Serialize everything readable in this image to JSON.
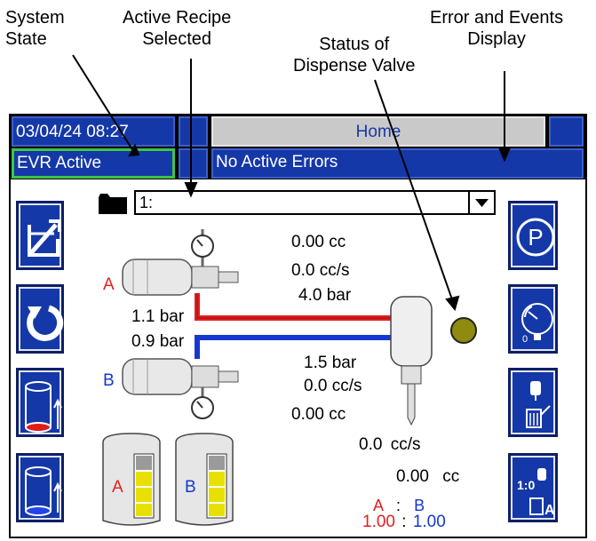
{
  "callouts": {
    "system_state": "System\nState",
    "active_recipe": "Active Recipe\nSelected",
    "dispense_valve": "Status of\nDispense Valve",
    "error_events": "Error and Events\nDisplay"
  },
  "header": {
    "datetime": "03/04/24 08:27",
    "screen_title": "Home",
    "system_state": "EVR Active",
    "error_status": "No Active Errors"
  },
  "recipe": {
    "selected": "1:"
  },
  "readouts": {
    "volume_total": "0.00 cc",
    "flow_rate": "0.0 cc/s",
    "mix_pressure": "4.0 bar",
    "pump_a_pressure": "1.1 bar",
    "pump_b_pressure": "0.9 bar",
    "b_pressure": "1.5 bar",
    "b_flow": "0.0 cc/s",
    "b_volume": "0.00 cc",
    "out_flow": "0.0",
    "out_flow_unit": "cc/s",
    "out_volume": "0.00",
    "out_volume_unit": "cc"
  },
  "labels": {
    "a": "A",
    "b": "B"
  },
  "ratio": {
    "a_label": "A",
    "sep": ":",
    "b_label": "B",
    "a_value": "1.00",
    "b_value": "1.00",
    "sep2": ":"
  },
  "tanks": {
    "a": "A",
    "b": "B"
  },
  "colors": {
    "a_line": "#e41e1e",
    "b_line": "#1538d0",
    "button_bg": "#1538a8",
    "state_border": "#3ec446",
    "valve_status": "#8f8a10"
  },
  "buttons_left": [
    "edit-recipe-icon",
    "refresh-icon",
    "fill-a-icon",
    "fill-b-icon"
  ],
  "buttons_right": [
    "park-icon",
    "pressure-gauge-icon",
    "dispense-icon",
    "ratio-dispense-icon"
  ]
}
